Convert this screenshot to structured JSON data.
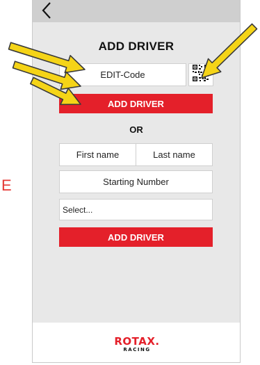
{
  "stray_label": "E",
  "header": {
    "back_icon": "chevron-left-icon",
    "title": "ADD DRIVER"
  },
  "edit_code": {
    "placeholder": "EDIT-Code",
    "qr_icon": "qr-code-icon"
  },
  "add_driver_code_button": "ADD DRIVER",
  "separator": "OR",
  "manual": {
    "first_name_placeholder": "First name",
    "last_name_placeholder": "Last name",
    "starting_number_placeholder": "Starting Number",
    "select_value": "Select...",
    "add_driver_button": "ADD DRIVER"
  },
  "footer": {
    "logo_main": "ROTAX.",
    "logo_sub": "RACING"
  },
  "annotation": {
    "arrow_color": "#f5d417",
    "arrow_count": 4
  },
  "colors": {
    "accent": "#e4202a",
    "panel": "#e8e8e8",
    "topbar": "#cfcfcf"
  }
}
